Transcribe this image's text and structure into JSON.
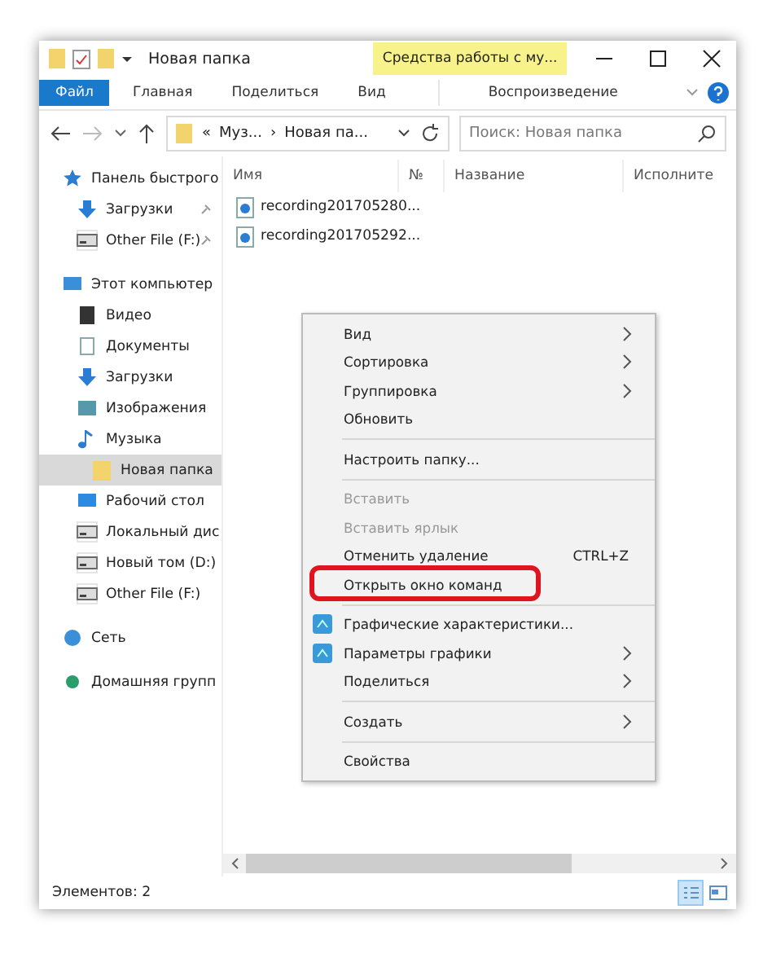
{
  "window": {
    "title": "Новая папка",
    "context_tab": "Средства работы с му..."
  },
  "ribbon_tabs": [
    {
      "label": "Файл",
      "selected": true
    },
    {
      "label": "Главная",
      "selected": false
    },
    {
      "label": "Поделиться",
      "selected": false
    },
    {
      "label": "Вид",
      "selected": false
    },
    {
      "label": "Воспроизведение",
      "selected": false
    }
  ],
  "address": {
    "crumbs": [
      "«",
      "Муз...",
      "›",
      "Новая па..."
    ]
  },
  "search": {
    "placeholder": "Поиск: Новая папка"
  },
  "sidebar": {
    "items": [
      {
        "label": "Панель быстрого",
        "selected": false,
        "children": [
          {
            "label": "Загрузки",
            "selected": false,
            "pinned": true
          },
          {
            "label": "Other File (F:)",
            "selected": false,
            "pinned": true
          }
        ]
      },
      {
        "label": "Этот компьютер",
        "selected": false,
        "children": [
          {
            "label": "Видео",
            "selected": false
          },
          {
            "label": "Документы",
            "selected": false
          },
          {
            "label": "Загрузки",
            "selected": false
          },
          {
            "label": "Изображения",
            "selected": false
          },
          {
            "label": "Музыка",
            "selected": false,
            "children": [
              {
                "label": "Новая папка",
                "selected": true
              }
            ]
          },
          {
            "label": "Рабочий стол",
            "selected": false
          },
          {
            "label": "Локальный дис",
            "selected": false
          },
          {
            "label": "Новый том (D:)",
            "selected": false
          },
          {
            "label": "Other File (F:)",
            "selected": false
          }
        ]
      },
      {
        "label": "Сеть",
        "selected": false
      },
      {
        "label": "Домашняя групп",
        "selected": false
      }
    ]
  },
  "table": {
    "columns": [
      "Имя",
      "№",
      "Название",
      "Исполните"
    ],
    "rows": [
      {
        "name": "recording201705280..."
      },
      {
        "name": "recording201705292..."
      }
    ]
  },
  "context_menu": {
    "items": [
      {
        "kind": "item",
        "label": "Вид",
        "submenu": true,
        "disabled": false
      },
      {
        "kind": "item",
        "label": "Сортировка",
        "submenu": true,
        "disabled": false
      },
      {
        "kind": "item",
        "label": "Группировка",
        "submenu": true,
        "disabled": false
      },
      {
        "kind": "item",
        "label": "Обновить",
        "disabled": false
      },
      {
        "kind": "separator"
      },
      {
        "kind": "item",
        "label": "Настроить папку...",
        "disabled": false
      },
      {
        "kind": "separator"
      },
      {
        "kind": "item",
        "label": "Вставить",
        "disabled": true
      },
      {
        "kind": "item",
        "label": "Вставить ярлык",
        "disabled": true
      },
      {
        "kind": "item",
        "label": "Отменить удаление",
        "shortcut": "CTRL+Z",
        "disabled": false
      },
      {
        "kind": "item",
        "label": "Открыть окно команд",
        "disabled": false,
        "highlighted": true
      },
      {
        "kind": "separator"
      },
      {
        "kind": "item",
        "label": "Графические характеристики...",
        "icon": true,
        "disabled": false
      },
      {
        "kind": "item",
        "label": "Параметры графики",
        "icon": true,
        "submenu": true,
        "disabled": false
      },
      {
        "kind": "item",
        "label": "Поделиться",
        "submenu": true,
        "disabled": false
      },
      {
        "kind": "separator"
      },
      {
        "kind": "item",
        "label": "Создать",
        "submenu": true,
        "disabled": false
      },
      {
        "kind": "separator"
      },
      {
        "kind": "item",
        "label": "Свойства",
        "disabled": false
      }
    ]
  },
  "status_bar": {
    "text": "Элементов: 2"
  }
}
